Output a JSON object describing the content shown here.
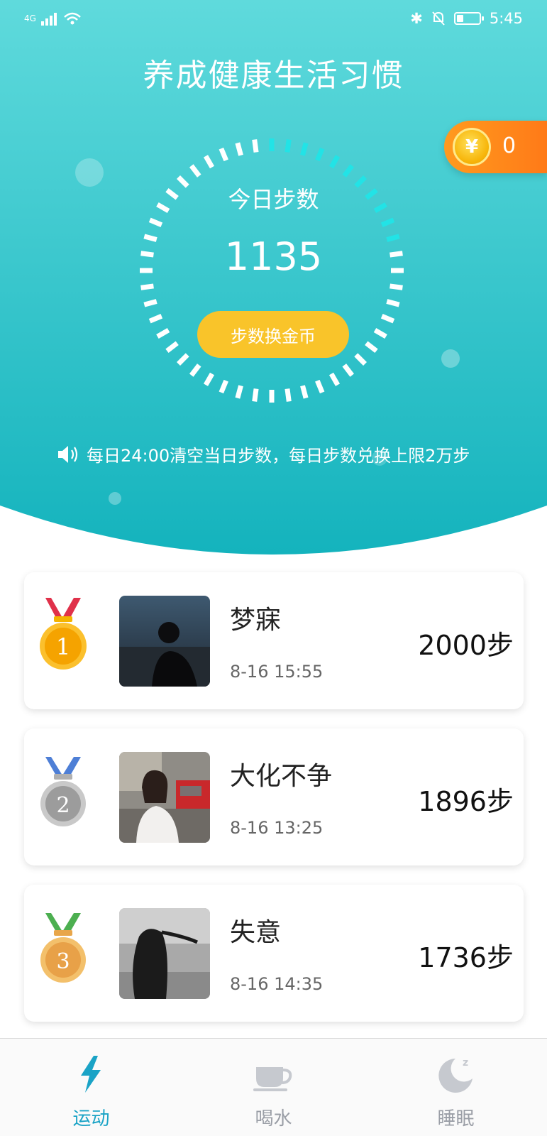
{
  "status_bar": {
    "network": "4G",
    "time": "5:45",
    "battery_level": 0.3
  },
  "header": {
    "title": "养成健康生活习惯",
    "coins": "0",
    "coin_symbol": "¥"
  },
  "dial": {
    "label": "今日步数",
    "steps": "1135",
    "exchange_button": "步数换金币",
    "progress": 0.22
  },
  "notice": "每日24:00清空当日步数，每日步数兑换上限2万步",
  "ranking": [
    {
      "rank": "1",
      "name": "梦寐",
      "time": "8-16 15:55",
      "steps": "2000步"
    },
    {
      "rank": "2",
      "name": "大化不争",
      "time": "8-16 13:25",
      "steps": "1896步"
    },
    {
      "rank": "3",
      "name": "失意",
      "time": "8-16 14:35",
      "steps": "1736步"
    }
  ],
  "tabs": [
    {
      "label": "运动",
      "icon": "lightning-icon",
      "active": true
    },
    {
      "label": "喝水",
      "icon": "cup-icon",
      "active": false
    },
    {
      "label": "睡眠",
      "icon": "moon-icon",
      "active": false
    }
  ],
  "colors": {
    "accent": "#1aa3c6",
    "header_top": "#5dd9dc",
    "header_bottom": "#1bb8c0",
    "button_yellow": "#f9c42a",
    "coin_orange": "#ff8a1c"
  }
}
